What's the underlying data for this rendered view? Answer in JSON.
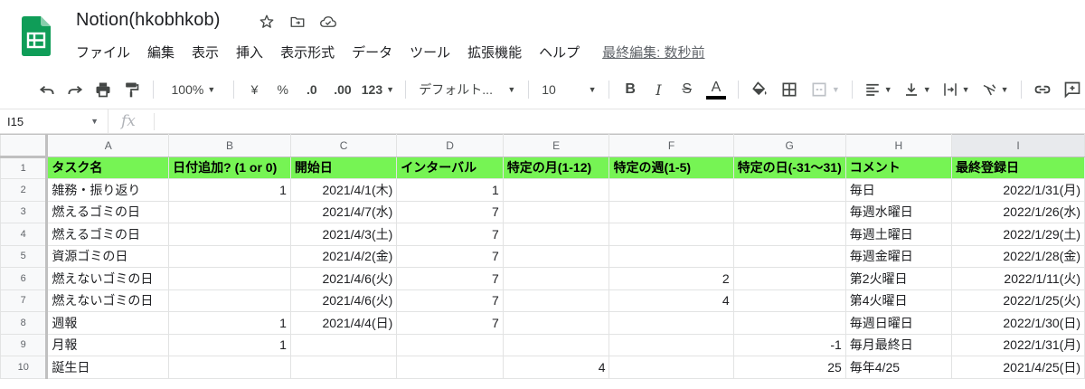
{
  "app": {
    "title": "Notion(hkobhkob)",
    "last_edit": "最終編集: 数秒前"
  },
  "menu": [
    "ファイル",
    "編集",
    "表示",
    "挿入",
    "表示形式",
    "データ",
    "ツール",
    "拡張機能",
    "ヘルプ"
  ],
  "toolbar": {
    "zoom": "100%",
    "currency": "¥",
    "percent": "%",
    "dec_decrease": ".0",
    "dec_increase": ".00",
    "format_more": "123",
    "font_family": "デフォルト...",
    "font_size": "10",
    "bold": "B",
    "italic": "I",
    "strike": "S",
    "text_color": "A"
  },
  "formula_bar": {
    "cell_ref": "I15",
    "fx": "fx"
  },
  "grid": {
    "columns": [
      "A",
      "B",
      "C",
      "D",
      "E",
      "F",
      "G",
      "H",
      "I"
    ],
    "header_row": [
      "タスク名",
      "日付追加? (1 or 0)",
      "開始日",
      "インターバル",
      "特定の月(1-12)",
      "特定の週(1-5)",
      "特定の日(-31〜31)",
      "コメント",
      "最終登録日"
    ],
    "rows": [
      [
        "雑務・振り返り",
        "1",
        "2021/4/1(木)",
        "1",
        "",
        "",
        "",
        "毎日",
        "2022/1/31(月)"
      ],
      [
        "燃えるゴミの日",
        "",
        "2021/4/7(水)",
        "7",
        "",
        "",
        "",
        "毎週水曜日",
        "2022/1/26(水)"
      ],
      [
        "燃えるゴミの日",
        "",
        "2021/4/3(土)",
        "7",
        "",
        "",
        "",
        "毎週土曜日",
        "2022/1/29(土)"
      ],
      [
        "資源ゴミの日",
        "",
        "2021/4/2(金)",
        "7",
        "",
        "",
        "",
        "毎週金曜日",
        "2022/1/28(金)"
      ],
      [
        "燃えないゴミの日",
        "",
        "2021/4/6(火)",
        "7",
        "",
        "2",
        "",
        "第2火曜日",
        "2022/1/11(火)"
      ],
      [
        "燃えないゴミの日",
        "",
        "2021/4/6(火)",
        "7",
        "",
        "4",
        "",
        "第4火曜日",
        "2022/1/25(火)"
      ],
      [
        "週報",
        "1",
        "2021/4/4(日)",
        "7",
        "",
        "",
        "",
        "毎週日曜日",
        "2022/1/30(日)"
      ],
      [
        "月報",
        "1",
        "",
        "",
        "",
        "",
        "-1",
        "毎月最終日",
        "2022/1/31(月)"
      ],
      [
        "誕生日",
        "",
        "",
        "",
        "4",
        "",
        "25",
        "毎年4/25",
        "2021/4/25(日)"
      ]
    ],
    "selected_column": "I"
  },
  "colors": {
    "header_fill": "#76f454",
    "logo_green": "#0f9d58"
  }
}
